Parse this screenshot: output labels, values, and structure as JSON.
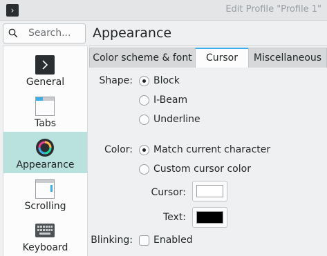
{
  "window": {
    "title": "Edit Profile \"Profile 1\"",
    "app_icon": "terminal-icon"
  },
  "sidebar": {
    "search_placeholder": "Search...",
    "items": [
      {
        "label": "General",
        "icon": "terminal-icon",
        "selected": false
      },
      {
        "label": "Tabs",
        "icon": "tabs-window-icon",
        "selected": false
      },
      {
        "label": "Appearance",
        "icon": "color-wheel-icon",
        "selected": true
      },
      {
        "label": "Scrolling",
        "icon": "scrolling-window-icon",
        "selected": false
      },
      {
        "label": "Keyboard",
        "icon": "keyboard-icon",
        "selected": false
      }
    ]
  },
  "header": {
    "title": "Appearance"
  },
  "tabs": [
    {
      "label": "Color scheme & font",
      "active": false
    },
    {
      "label": "Cursor",
      "active": true
    },
    {
      "label": "Miscellaneous",
      "active": false
    }
  ],
  "cursor": {
    "shape_label": "Shape:",
    "shape_options": [
      {
        "label": "Block",
        "checked": true
      },
      {
        "label": "I-Beam",
        "checked": false
      },
      {
        "label": "Underline",
        "checked": false
      }
    ],
    "color_label": "Color:",
    "color_options": [
      {
        "label": "Match current character",
        "checked": true
      },
      {
        "label": "Custom cursor color",
        "checked": false
      }
    ],
    "cursor_color_label": "Cursor:",
    "cursor_color": "#ffffff",
    "text_color_label": "Text:",
    "text_color": "#000000",
    "blinking_label": "Blinking:",
    "blinking_option": "Enabled",
    "blinking_checked": false
  },
  "colors": {
    "selection": "#b9e1de",
    "accent": "#3daee9"
  }
}
